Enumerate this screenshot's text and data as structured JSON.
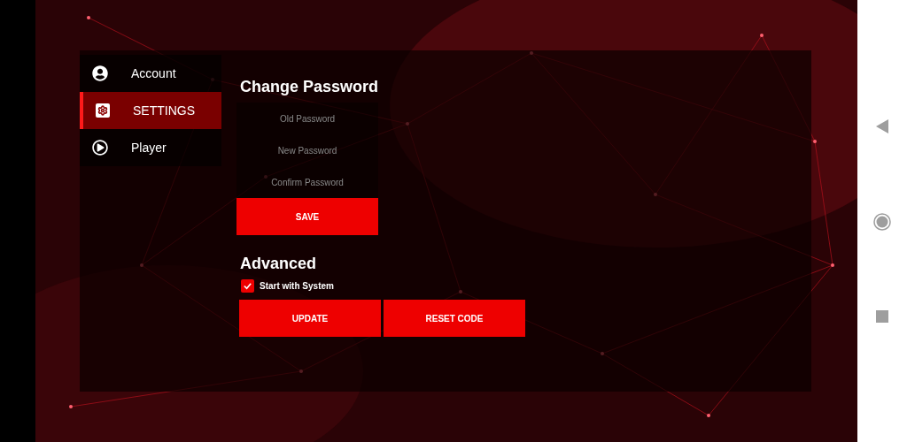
{
  "sidebar": {
    "items": [
      {
        "kind": "account",
        "label": "Account",
        "selected": false
      },
      {
        "kind": "settings",
        "label": "SETTINGS",
        "selected": true
      },
      {
        "kind": "player",
        "label": "Player",
        "selected": false
      }
    ]
  },
  "change_password": {
    "title": "Change Password",
    "fields": [
      {
        "placeholder": "Old Password"
      },
      {
        "placeholder": "New Password"
      },
      {
        "placeholder": "Confirm Password"
      }
    ],
    "save_button": "SAVE"
  },
  "advanced": {
    "title": "Advanced",
    "checkbox": {
      "label": "Start with System",
      "checked": true
    },
    "buttons": [
      "UPDATE",
      "RESET CODE"
    ]
  }
}
